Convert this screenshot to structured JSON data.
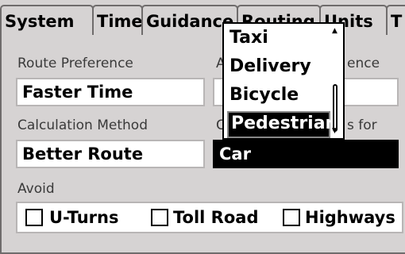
{
  "tabs": [
    {
      "label": "System"
    },
    {
      "label": "Time"
    },
    {
      "label": "Guidance"
    },
    {
      "label": "Routing"
    },
    {
      "label": "Units"
    },
    {
      "label": "T"
    }
  ],
  "route_preference": {
    "label": "Route Preference",
    "value": "Faster Time"
  },
  "second_preference": {
    "label_start": "A",
    "label_end": "ence"
  },
  "calculation_method": {
    "label": "Calculation Method",
    "value": "Better Route"
  },
  "calculate_for": {
    "label_start": "C",
    "label_end": "s for",
    "value": "Car"
  },
  "avoid": {
    "label": "Avoid",
    "options": [
      {
        "label": "U-Turns",
        "checked": false
      },
      {
        "label": "Toll Road",
        "checked": false
      },
      {
        "label": "Highways",
        "checked": false
      }
    ]
  },
  "dropdown": {
    "items": [
      "Taxi",
      "Delivery",
      "Bicycle",
      "Pedestrian"
    ],
    "selected": "Pedestrian",
    "scroll_up_icon": "triangle-up",
    "scroll_down_icon": "triangle-down"
  },
  "colors": {
    "panel": "#d6d3d3",
    "border": "#6f6c6c",
    "selection": "#000000"
  }
}
